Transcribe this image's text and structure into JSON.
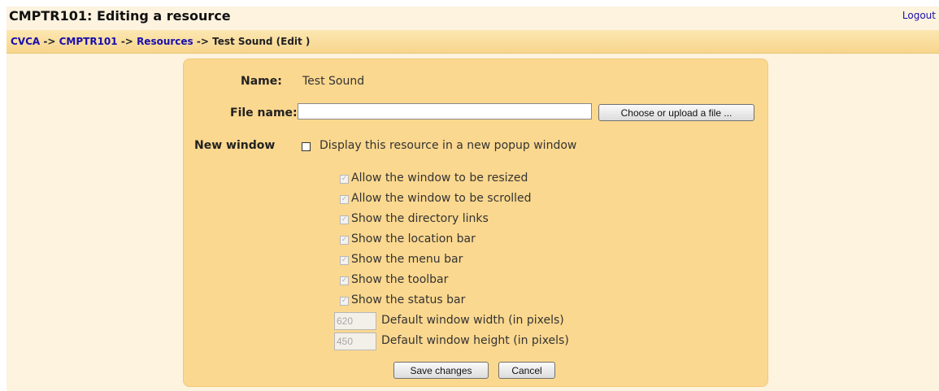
{
  "header": {
    "title": "CMPTR101: Editing a resource",
    "logout_label": "Logout"
  },
  "breadcrumb": {
    "items": [
      "CVCA",
      "CMPTR101",
      "Resources"
    ],
    "separator": "->",
    "current": "Test Sound (Edit )"
  },
  "form": {
    "name_label": "Name:",
    "name_value": "Test Sound",
    "filename_label": "File name:",
    "filename_value": "",
    "choose_button": "Choose or upload a file ...",
    "new_window_label": "New window",
    "new_window_option": "Display this resource in a new popup window",
    "new_window_checked": false,
    "window_options": [
      {
        "label": "Allow the window to be resized",
        "checked": true
      },
      {
        "label": "Allow the window to be scrolled",
        "checked": true
      },
      {
        "label": "Show the directory links",
        "checked": true
      },
      {
        "label": "Show the location bar",
        "checked": true
      },
      {
        "label": "Show the menu bar",
        "checked": true
      },
      {
        "label": "Show the toolbar",
        "checked": true
      },
      {
        "label": "Show the status bar",
        "checked": true
      }
    ],
    "width_value": "620",
    "width_label": "Default window width (in pixels)",
    "height_value": "450",
    "height_label": "Default window height (in pixels)",
    "save_button": "Save changes",
    "cancel_button": "Cancel"
  },
  "colors": {
    "page_bg": "#fdf3df",
    "nav_bg": "#f7d58c",
    "panel_bg": "#fbd88f",
    "link": "#1a0dab"
  }
}
